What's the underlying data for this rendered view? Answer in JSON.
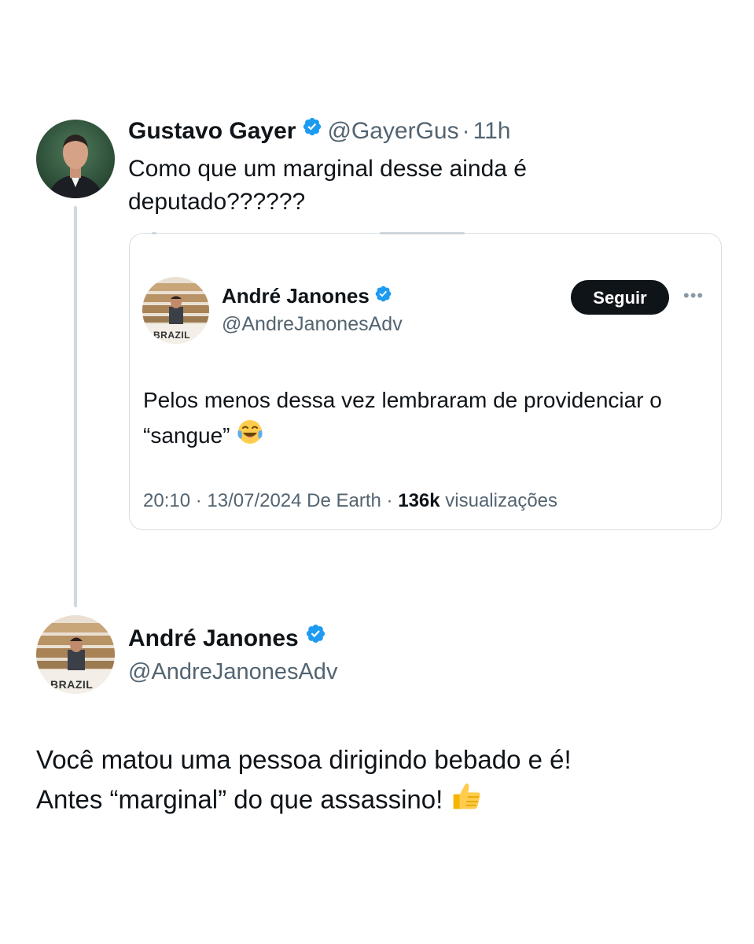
{
  "tweet": {
    "author_name": "Gustavo Gayer",
    "handle": "@GayerGus",
    "separator": "·",
    "time": "11h",
    "text": "Como que um marginal desse ainda é deputado??????",
    "avatar_icon": "profile-photo-man-suit"
  },
  "quoted": {
    "author_name": "André Janones",
    "handle": "@AndreJanonesAdv",
    "follow_label": "Seguir",
    "more_icon": "more-dots-icon",
    "text": "Pelos menos dessa vez lembraram de providenciar o “sangue”",
    "emoji": "face-with-tears-of-joy",
    "meta_time": "20:10 · 13/07/2024 De Earth ·",
    "meta_views_count": "136k",
    "meta_views_label": "visualizações",
    "avatar_caption": "BRAZIL"
  },
  "reply": {
    "author_name": "André Janones",
    "handle": "@AndreJanonesAdv",
    "text_line1": "Você matou uma pessoa dirigindo bebado e é!",
    "text_line2": "Antes “marginal” do que assassino!",
    "emoji": "thumbs-up",
    "avatar_caption": "BRAZIL"
  },
  "colors": {
    "verified_blue": "#1d9bf0",
    "text_primary": "#0f1419",
    "text_secondary": "#536471",
    "thread_line": "#cfd9de"
  }
}
